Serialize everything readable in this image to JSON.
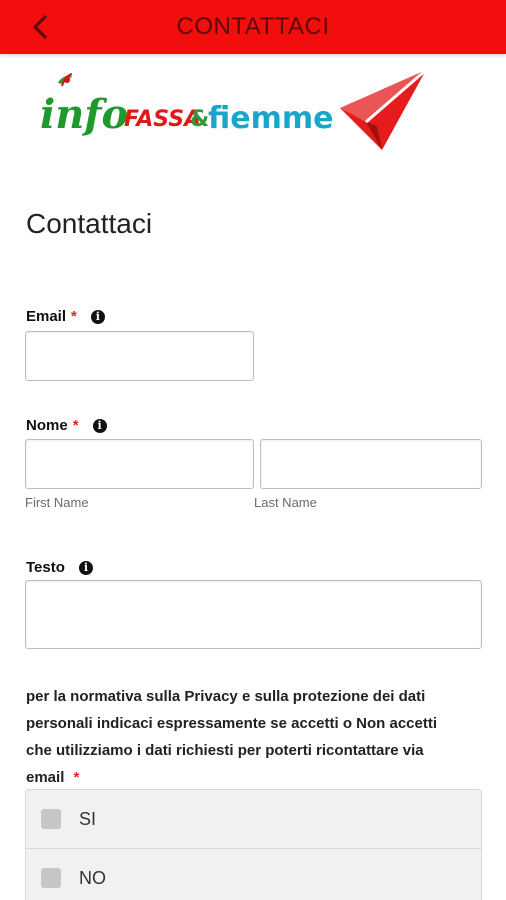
{
  "header": {
    "title": "CONTATTACI",
    "back_icon": "chevron-left-icon",
    "bg_color": "#f30e0e"
  },
  "logo": {
    "part_info": "info",
    "part_fassa": "FASSA",
    "part_amp": "&",
    "part_fiemme": "fiemme",
    "icon": "paper-plane-icon"
  },
  "page_title": "Contattaci",
  "form": {
    "email": {
      "label": "Email",
      "required_mark": "*",
      "info_icon": "info-icon",
      "value": ""
    },
    "nome": {
      "label": "Nome",
      "required_mark": "*",
      "info_icon": "info-icon",
      "first_hint": "First Name",
      "last_hint": "Last Name"
    },
    "testo": {
      "label": "Testo",
      "info_icon": "info-icon",
      "value": ""
    },
    "privacy": {
      "text": "per la normativa sulla Privacy e sulla protezione dei dati personali indicaci espressamente se accetti o Non accetti che utilizziamo i dati richiesti per poterti ricontattare via email",
      "required_mark": "*",
      "options": [
        {
          "label": "SI",
          "checked": false
        },
        {
          "label": "NO",
          "checked": false
        }
      ]
    }
  }
}
